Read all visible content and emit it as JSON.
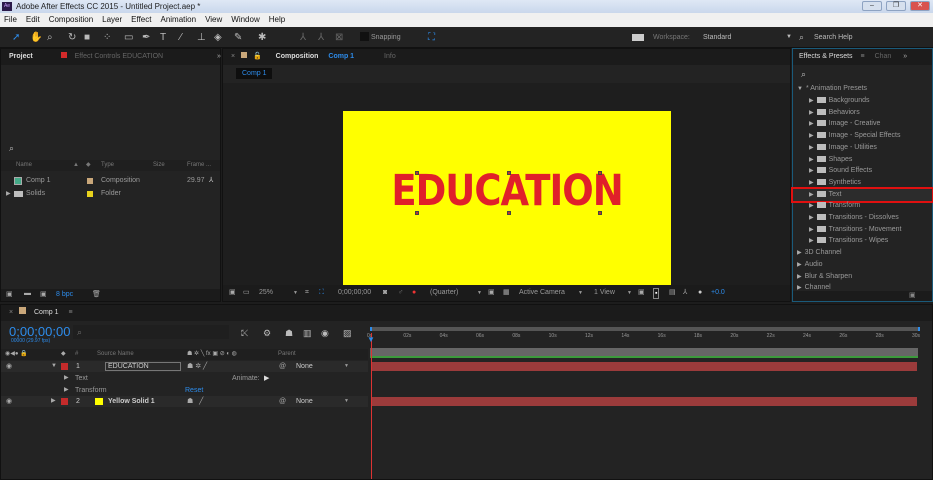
{
  "window": {
    "title": "Adobe After Effects CC 2015 - Untitled Project.aep *",
    "icon": "Ae",
    "min": "–",
    "max": "❐",
    "close": "✕"
  },
  "menu": [
    "File",
    "Edit",
    "Composition",
    "Layer",
    "Effect",
    "Animation",
    "View",
    "Window",
    "Help"
  ],
  "toolbar": {
    "snapping": "Snapping",
    "workspace_label": "Workspace:",
    "workspace_value": "Standard",
    "search_help": "Search Help"
  },
  "project_panel": {
    "tab": "Project",
    "effect_controls_tab": "Effect Controls EDUCATION",
    "columns": [
      "Name",
      "Type",
      "Size",
      "Frame ..."
    ],
    "items": [
      {
        "name": "Comp 1",
        "type": "Composition",
        "frame_rate": "29.97",
        "label_color": "#c9a77a"
      },
      {
        "name": "Solids",
        "type": "Folder",
        "label_color": "#e8d21d"
      }
    ],
    "bpc": "8 bpc"
  },
  "comp_panel": {
    "tab_prefix": "Composition",
    "tab_comp": "Comp 1",
    "info_tab": "Info",
    "subtab": "Comp 1",
    "text": "EDUCATION",
    "background": "#ffff00",
    "text_color": "#e0202a",
    "bottom": {
      "zoom": "25%",
      "timecode": "0;00;00;00",
      "resolution": "(Quarter)",
      "camera": "Active Camera",
      "views": "1 View",
      "exposure": "+0.0"
    }
  },
  "effects_panel": {
    "tab": "Effects & Presets",
    "chan_tab": "Chan",
    "root": "* Animation Presets",
    "presets": [
      "Backgrounds",
      "Behaviors",
      "Image - Creative",
      "Image - Special Effects",
      "Image - Utilities",
      "Shapes",
      "Sound Effects",
      "Synthetics",
      "Text",
      "Transform",
      "Transitions - Dissolves",
      "Transitions - Movement",
      "Transitions - Wipes"
    ],
    "highlighted": "Text",
    "categories": [
      "3D Channel",
      "Audio",
      "Blur & Sharpen",
      "Channel"
    ]
  },
  "timeline": {
    "tab": "Comp 1",
    "timecode": "0;00;00;00",
    "frame_info": "00000 (29.97 fps)",
    "col_source": "Source Name",
    "col_parent": "Parent",
    "col_num": "#",
    "layers": [
      {
        "num": "1",
        "name": "EDUCATION",
        "parent": "None"
      },
      {
        "num": "2",
        "name": "Yellow Solid 1",
        "parent": "None"
      }
    ],
    "text_prop": "Text",
    "animate": "Animate:",
    "transform_prop": "Transform",
    "reset": "Reset",
    "ruler": [
      "0s",
      "02s",
      "04s",
      "06s",
      "08s",
      "10s",
      "12s",
      "14s",
      "16s",
      "18s",
      "20s",
      "22s",
      "24s",
      "26s",
      "28s",
      "30s"
    ]
  }
}
